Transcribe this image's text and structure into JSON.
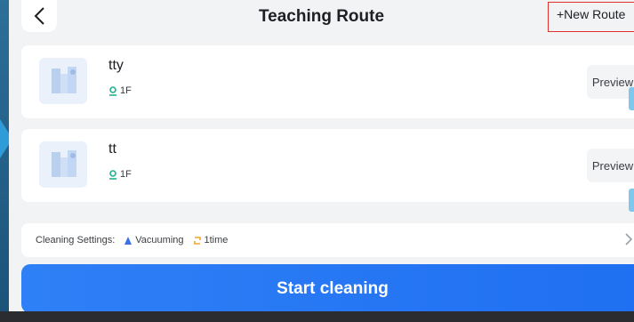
{
  "header": {
    "title": "Teaching Route",
    "new_route_label": "+New Route",
    "back_icon": "chevron-left-icon"
  },
  "routes": [
    {
      "name": "tty",
      "floor": "1F",
      "preview_label": "Preview"
    },
    {
      "name": "tt",
      "floor": "1F",
      "preview_label": "Preview"
    }
  ],
  "settings": {
    "label": "Cleaning Settings:",
    "mode": "Vacuuming",
    "times": "1time"
  },
  "start_button": {
    "label": "Start cleaning"
  },
  "colors": {
    "accent": "#2f80f6",
    "highlight_border": "#e0312c",
    "floor_icon": "#22b08f",
    "vacuum_icon": "#3a6fe8",
    "times_icon": "#f0a431"
  }
}
